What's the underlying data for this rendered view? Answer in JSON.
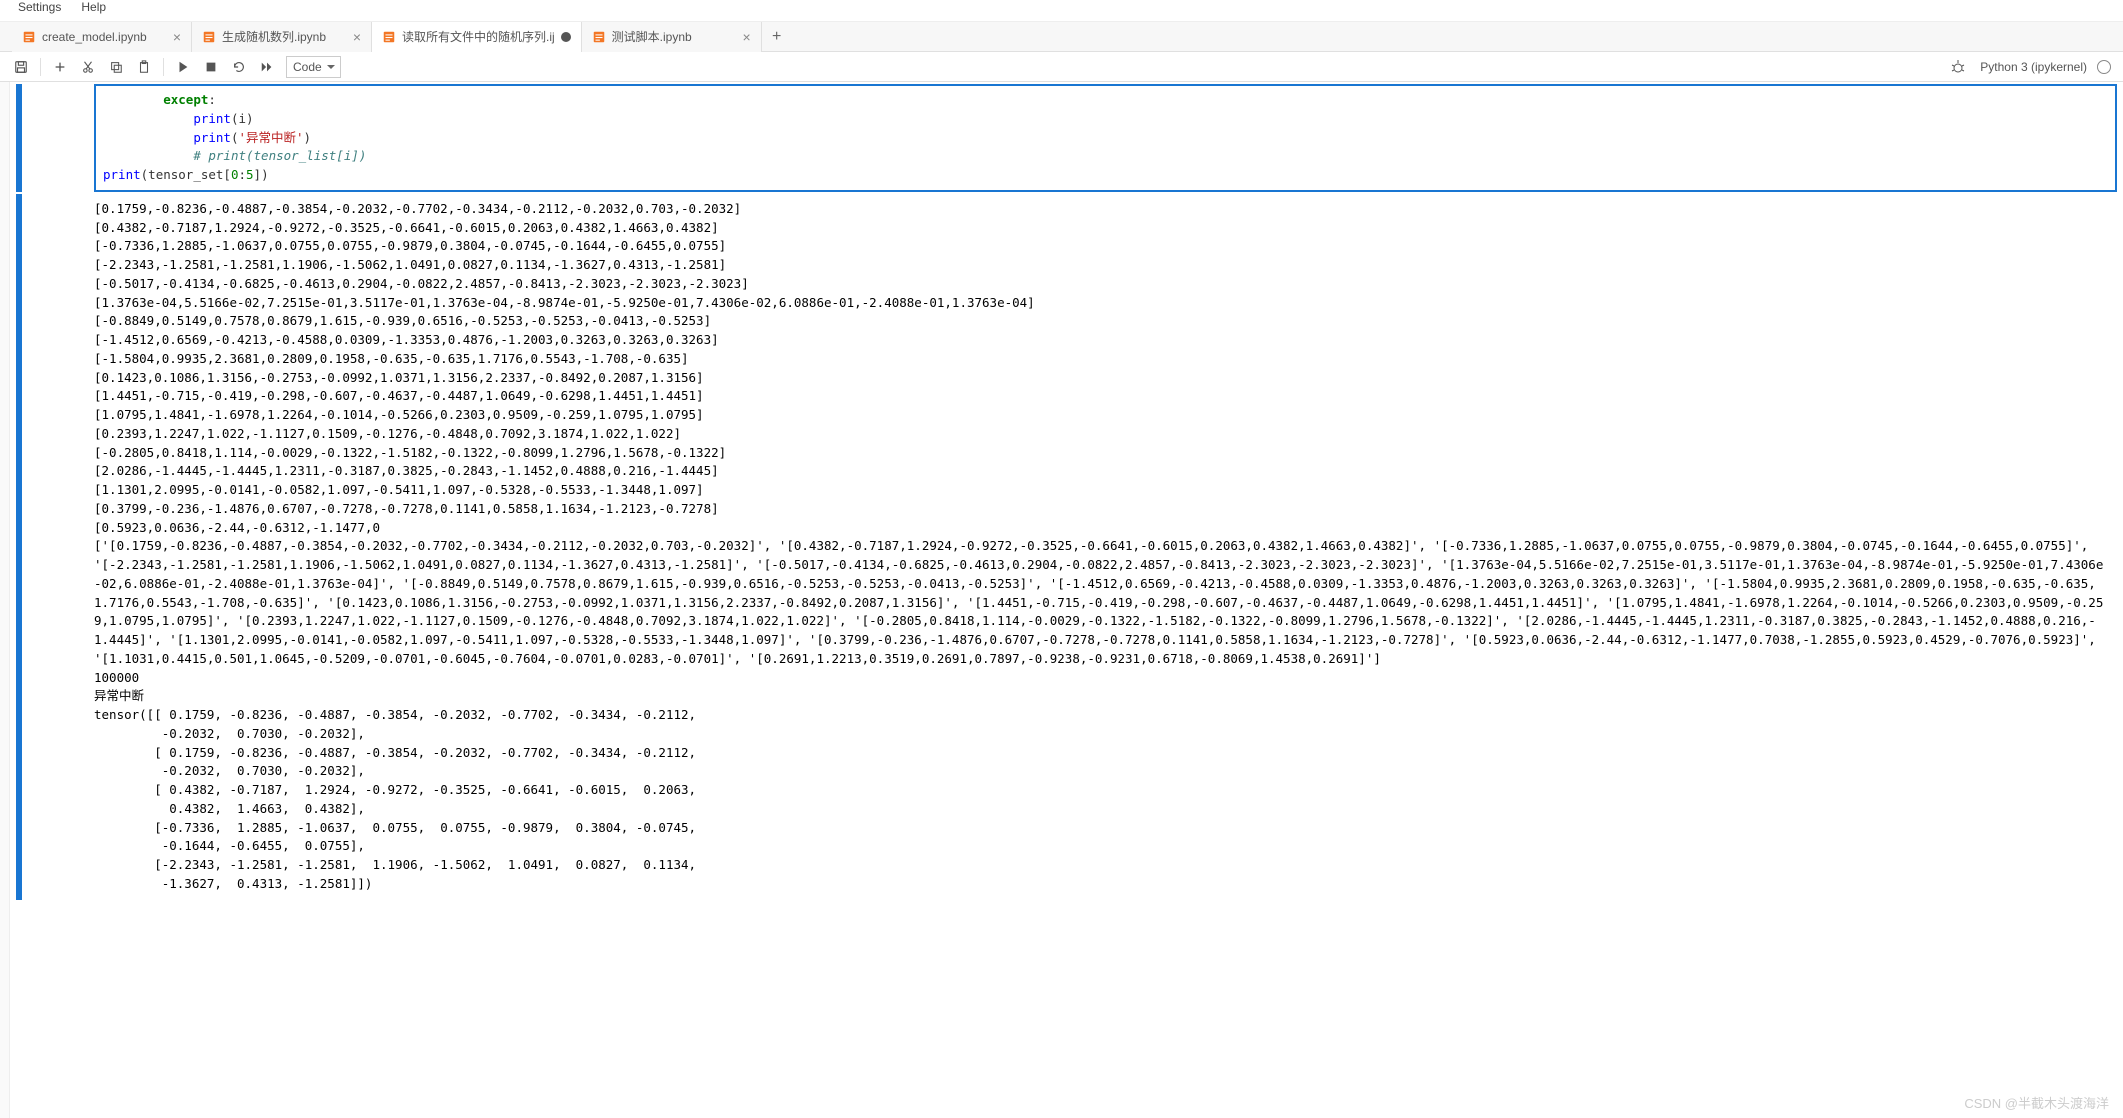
{
  "menu": {
    "settings": "Settings",
    "help": "Help"
  },
  "tabs": [
    {
      "label": "create_model.ipynb",
      "active": false,
      "dirty": false
    },
    {
      "label": "生成随机数列.ipynb",
      "active": false,
      "dirty": false
    },
    {
      "label": "读取所有文件中的随机序列.ij",
      "active": true,
      "dirty": true
    },
    {
      "label": "测试脚本.ipynb",
      "active": false,
      "dirty": false
    }
  ],
  "toolbar": {
    "celltype": "Code",
    "kernel": "Python 3 (ipykernel)"
  },
  "code": {
    "lines": [
      {
        "indent": 2,
        "tokens": [
          {
            "t": "kw",
            "v": "except"
          },
          {
            "t": "p",
            "v": ":"
          }
        ]
      },
      {
        "indent": 3,
        "tokens": [
          {
            "t": "fn",
            "v": "print"
          },
          {
            "t": "p",
            "v": "(i)"
          }
        ]
      },
      {
        "indent": 3,
        "tokens": [
          {
            "t": "fn",
            "v": "print"
          },
          {
            "t": "p",
            "v": "("
          },
          {
            "t": "str",
            "v": "'异常中断'"
          },
          {
            "t": "p",
            "v": ")"
          }
        ]
      },
      {
        "indent": 3,
        "tokens": [
          {
            "t": "com",
            "v": "# print(tensor_list[i])"
          }
        ]
      },
      {
        "indent": 0,
        "tokens": [
          {
            "t": "fn",
            "v": "print"
          },
          {
            "t": "p",
            "v": "(tensor_set["
          },
          {
            "t": "num",
            "v": "0"
          },
          {
            "t": "p",
            "v": ":"
          },
          {
            "t": "num",
            "v": "5"
          },
          {
            "t": "p",
            "v": "])"
          }
        ]
      },
      {
        "indent": 0,
        "tokens": []
      }
    ]
  },
  "output_lines": [
    "[0.1759,-0.8236,-0.4887,-0.3854,-0.2032,-0.7702,-0.3434,-0.2112,-0.2032,0.703,-0.2032]",
    "[0.4382,-0.7187,1.2924,-0.9272,-0.3525,-0.6641,-0.6015,0.2063,0.4382,1.4663,0.4382]",
    "[-0.7336,1.2885,-1.0637,0.0755,0.0755,-0.9879,0.3804,-0.0745,-0.1644,-0.6455,0.0755]",
    "[-2.2343,-1.2581,-1.2581,1.1906,-1.5062,1.0491,0.0827,0.1134,-1.3627,0.4313,-1.2581]",
    "[-0.5017,-0.4134,-0.6825,-0.4613,0.2904,-0.0822,2.4857,-0.8413,-2.3023,-2.3023,-2.3023]",
    "[1.3763e-04,5.5166e-02,7.2515e-01,3.5117e-01,1.3763e-04,-8.9874e-01,-5.9250e-01,7.4306e-02,6.0886e-01,-2.4088e-01,1.3763e-04]",
    "[-0.8849,0.5149,0.7578,0.8679,1.615,-0.939,0.6516,-0.5253,-0.5253,-0.0413,-0.5253]",
    "[-1.4512,0.6569,-0.4213,-0.4588,0.0309,-1.3353,0.4876,-1.2003,0.3263,0.3263,0.3263]",
    "[-1.5804,0.9935,2.3681,0.2809,0.1958,-0.635,-0.635,1.7176,0.5543,-1.708,-0.635]",
    "[0.1423,0.1086,1.3156,-0.2753,-0.0992,1.0371,1.3156,2.2337,-0.8492,0.2087,1.3156]",
    "[1.4451,-0.715,-0.419,-0.298,-0.607,-0.4637,-0.4487,1.0649,-0.6298,1.4451,1.4451]",
    "[1.0795,1.4841,-1.6978,1.2264,-0.1014,-0.5266,0.2303,0.9509,-0.259,1.0795,1.0795]",
    "[0.2393,1.2247,1.022,-1.1127,0.1509,-0.1276,-0.4848,0.7092,3.1874,1.022,1.022]",
    "[-0.2805,0.8418,1.114,-0.0029,-0.1322,-1.5182,-0.1322,-0.8099,1.2796,1.5678,-0.1322]",
    "[2.0286,-1.4445,-1.4445,1.2311,-0.3187,0.3825,-0.2843,-1.1452,0.4888,0.216,-1.4445]",
    "[1.1301,2.0995,-0.0141,-0.0582,1.097,-0.5411,1.097,-0.5328,-0.5533,-1.3448,1.097]",
    "[0.3799,-0.236,-1.4876,0.6707,-0.7278,-0.7278,0.1141,0.5858,1.1634,-1.2123,-0.7278]",
    "[0.5923,0.0636,-2.44,-0.6312,-1.1477,0",
    "['[0.1759,-0.8236,-0.4887,-0.3854,-0.2032,-0.7702,-0.3434,-0.2112,-0.2032,0.703,-0.2032]', '[0.4382,-0.7187,1.2924,-0.9272,-0.3525,-0.6641,-0.6015,0.2063,0.4382,1.4663,0.4382]', '[-0.7336,1.2885,-1.0637,0.0755,0.0755,-0.9879,0.3804,-0.0745,-0.1644,-0.6455,0.0755]', '[-2.2343,-1.2581,-1.2581,1.1906,-1.5062,1.0491,0.0827,0.1134,-1.3627,0.4313,-1.2581]', '[-0.5017,-0.4134,-0.6825,-0.4613,0.2904,-0.0822,2.4857,-0.8413,-2.3023,-2.3023,-2.3023]', '[1.3763e-04,5.5166e-02,7.2515e-01,3.5117e-01,1.3763e-04,-8.9874e-01,-5.9250e-01,7.4306e-02,6.0886e-01,-2.4088e-01,1.3763e-04]', '[-0.8849,0.5149,0.7578,0.8679,1.615,-0.939,0.6516,-0.5253,-0.5253,-0.0413,-0.5253]', '[-1.4512,0.6569,-0.4213,-0.4588,0.0309,-1.3353,0.4876,-1.2003,0.3263,0.3263,0.3263]', '[-1.5804,0.9935,2.3681,0.2809,0.1958,-0.635,-0.635,1.7176,0.5543,-1.708,-0.635]', '[0.1423,0.1086,1.3156,-0.2753,-0.0992,1.0371,1.3156,2.2337,-0.8492,0.2087,1.3156]', '[1.4451,-0.715,-0.419,-0.298,-0.607,-0.4637,-0.4487,1.0649,-0.6298,1.4451,1.4451]', '[1.0795,1.4841,-1.6978,1.2264,-0.1014,-0.5266,0.2303,0.9509,-0.259,1.0795,1.0795]', '[0.2393,1.2247,1.022,-1.1127,0.1509,-0.1276,-0.4848,0.7092,3.1874,1.022,1.022]', '[-0.2805,0.8418,1.114,-0.0029,-0.1322,-1.5182,-0.1322,-0.8099,1.2796,1.5678,-0.1322]', '[2.0286,-1.4445,-1.4445,1.2311,-0.3187,0.3825,-0.2843,-1.1452,0.4888,0.216,-1.4445]', '[1.1301,2.0995,-0.0141,-0.0582,1.097,-0.5411,1.097,-0.5328,-0.5533,-1.3448,1.097]', '[0.3799,-0.236,-1.4876,0.6707,-0.7278,-0.7278,0.1141,0.5858,1.1634,-1.2123,-0.7278]', '[0.5923,0.0636,-2.44,-0.6312,-1.1477,0.7038,-1.2855,0.5923,0.4529,-0.7076,0.5923]', '[1.1031,0.4415,0.501,1.0645,-0.5209,-0.0701,-0.6045,-0.7604,-0.0701,0.0283,-0.0701]', '[0.2691,1.2213,0.3519,0.2691,0.7897,-0.9238,-0.9231,0.6718,-0.8069,1.4538,0.2691]']",
    "100000",
    "异常中断",
    "tensor([[ 0.1759, -0.8236, -0.4887, -0.3854, -0.2032, -0.7702, -0.3434, -0.2112,",
    "         -0.2032,  0.7030, -0.2032],",
    "        [ 0.1759, -0.8236, -0.4887, -0.3854, -0.2032, -0.7702, -0.3434, -0.2112,",
    "         -0.2032,  0.7030, -0.2032],",
    "        [ 0.4382, -0.7187,  1.2924, -0.9272, -0.3525, -0.6641, -0.6015,  0.2063,",
    "          0.4382,  1.4663,  0.4382],",
    "        [-0.7336,  1.2885, -1.0637,  0.0755,  0.0755, -0.9879,  0.3804, -0.0745,",
    "         -0.1644, -0.6455,  0.0755],",
    "        [-2.2343, -1.2581, -1.2581,  1.1906, -1.5062,  1.0491,  0.0827,  0.1134,",
    "         -1.3627,  0.4313, -1.2581]])"
  ],
  "watermark": "CSDN @半截木头渡海洋"
}
